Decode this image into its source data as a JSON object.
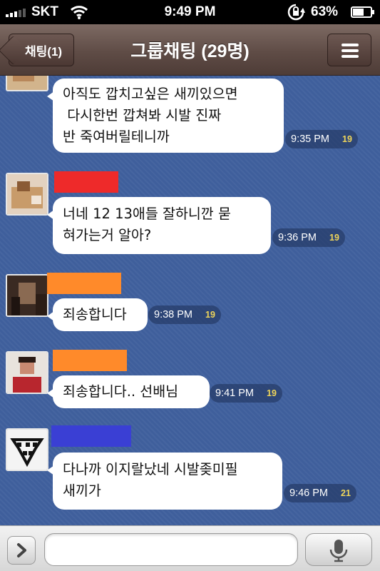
{
  "status_bar": {
    "carrier": "SKT",
    "time": "9:49 PM",
    "battery_text": "63%",
    "battery_level": 0.63,
    "icons": [
      "signal-icon",
      "wifi-icon",
      "rotation-lock-icon",
      "battery-icon"
    ]
  },
  "nav": {
    "back_label": "채팅(1)",
    "title": "그룹채팅 (29명)",
    "menu_icon": "hamburger-menu-icon"
  },
  "messages": [
    {
      "text": "아직도 깝치고싶은 새끼있으면\n 다시한번 깝쳐봐 시발 진짜\n반 죽여버릴테니까",
      "time": "9:35 PM",
      "count": "19",
      "name_tag_color": ""
    },
    {
      "text": "너네 12 13애들 잘하니깐 묻\n혀가는거 알아?",
      "time": "9:36 PM",
      "count": "19",
      "name_tag_color": "#ee2a2a"
    },
    {
      "text": "죄송합니다",
      "time": "9:38 PM",
      "count": "19",
      "name_tag_color": "#ff8a2a"
    },
    {
      "text": "죄송합니다.. 선배님",
      "time": "9:41 PM",
      "count": "19",
      "name_tag_color": "#ff8a2a"
    },
    {
      "text": "다나까 이지랄났네 시발좆미필\n새끼가",
      "time": "9:46 PM",
      "count": "21",
      "name_tag_color": "#3a3fd4"
    }
  ],
  "input_bar": {
    "message_value": "",
    "icons": [
      "expand-arrow-icon",
      "emoji-icon",
      "microphone-icon"
    ]
  }
}
